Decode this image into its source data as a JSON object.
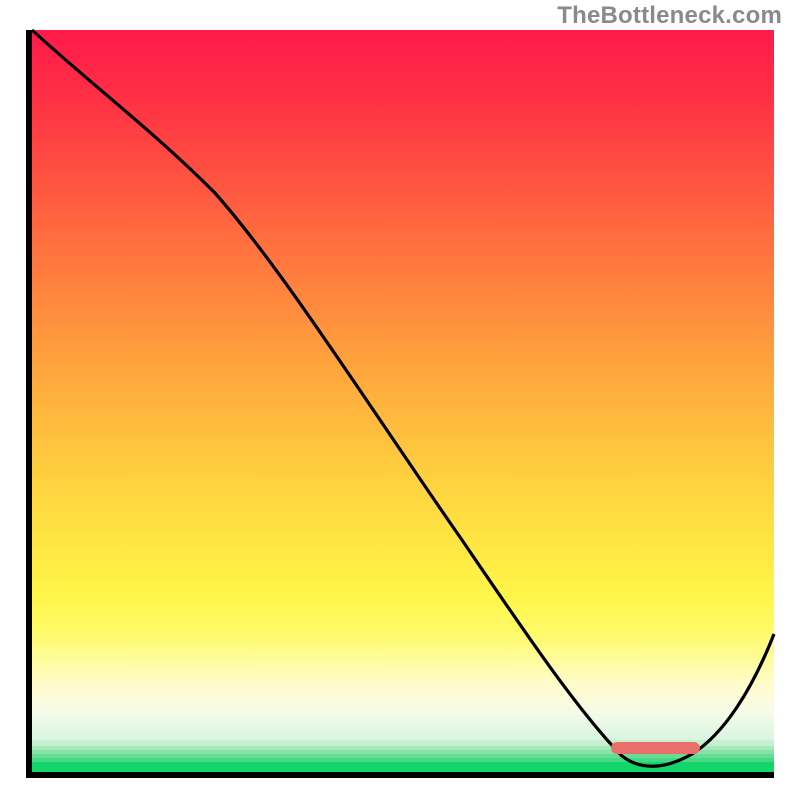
{
  "watermark": "TheBottleneck.com",
  "chart_data": {
    "type": "line",
    "title": "",
    "xlabel": "",
    "ylabel": "",
    "xlim": [
      0,
      100
    ],
    "ylim": [
      0,
      100
    ],
    "x": [
      0,
      10,
      20,
      30,
      40,
      50,
      60,
      70,
      75,
      80,
      85,
      90,
      100
    ],
    "values": [
      100,
      93,
      85,
      74,
      61,
      48,
      35,
      21,
      11,
      2,
      0,
      2,
      19
    ],
    "optimal_range_x": [
      78,
      90
    ],
    "gradient_stops": [
      {
        "pct": 0,
        "color": "#ff1a49"
      },
      {
        "pct": 22,
        "color": "#ff5640"
      },
      {
        "pct": 48,
        "color": "#ffa63d"
      },
      {
        "pct": 72,
        "color": "#ffe642"
      },
      {
        "pct": 88,
        "color": "#fffb8a"
      },
      {
        "pct": 95,
        "color": "#eefbe6"
      },
      {
        "pct": 97,
        "color": "#a7e8b9"
      },
      {
        "pct": 100,
        "color": "#13d66a"
      }
    ]
  }
}
